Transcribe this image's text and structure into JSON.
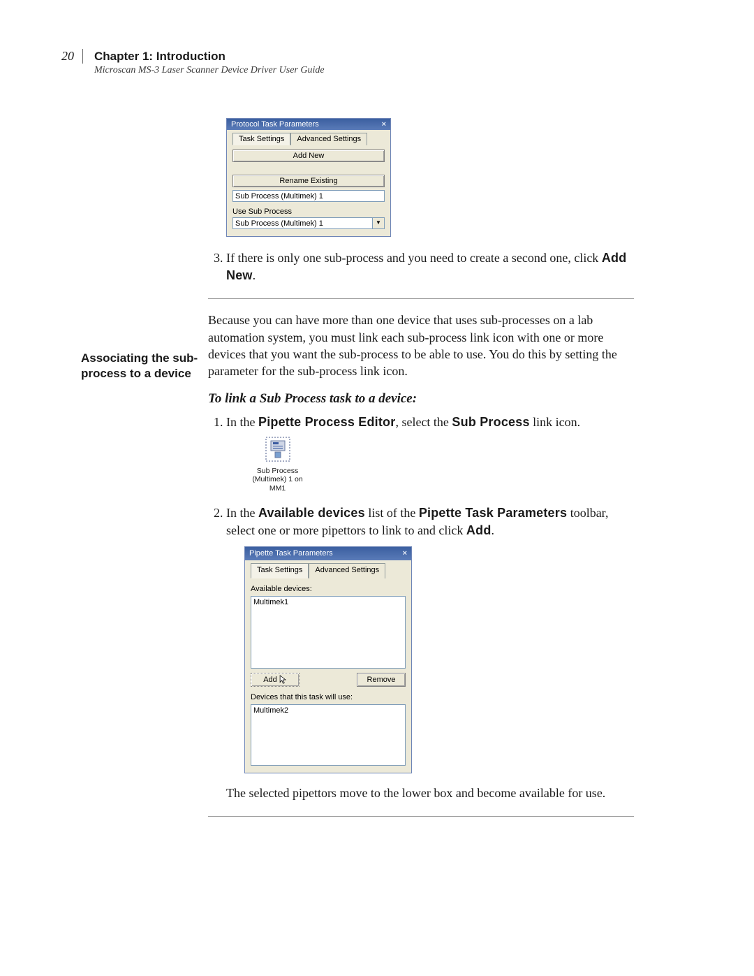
{
  "page": {
    "number": "20",
    "chapter": "Chapter 1: Introduction",
    "guide": "Microscan MS-3 Laser Scanner Device Driver User Guide"
  },
  "shot1": {
    "title": "Protocol Task Parameters",
    "close": "×",
    "tab1": "Task Settings",
    "tab2": "Advanced Settings",
    "addNew": "Add New",
    "rename": "Rename Existing",
    "renameVal": "Sub Process (Multimek) 1",
    "useLabel": "Use Sub Process",
    "selectVal": "Sub Process (Multimek) 1",
    "dropGlyph": "▼"
  },
  "step3": {
    "pre": "If there is only one sub-process and you need to create a second one, click ",
    "bold": "Add New",
    "post": "."
  },
  "assoc": {
    "heading": "Associating the sub-process to a device",
    "para": "Because you can have more than one device that uses sub-processes on a lab automation system, you must link each sub-process link icon with one or more devices that you want the sub-process to be able to use. You do this by setting the parameter for the sub-process link icon.",
    "subhead": "To link a Sub Process task to a device:"
  },
  "step1": {
    "a": "In the ",
    "b": "Pipette Process Editor",
    "c": ", select the ",
    "d": "Sub Process",
    "e": " link icon."
  },
  "icon": {
    "line1": "Sub Process",
    "line2": "(Multimek) 1 on",
    "line3": "MM1"
  },
  "step2": {
    "a": "In the ",
    "b": "Available devices",
    "c": " list of the ",
    "d": "Pipette Task Parameters",
    "e": " toolbar, select one or more pipettors to link to and click ",
    "f": "Add",
    "g": "."
  },
  "shot2": {
    "title": "Pipette Task Parameters",
    "close": "×",
    "tab1": "Task Settings",
    "tab2": "Advanced Settings",
    "availLabel": "Available devices:",
    "availItem": "Multimek1",
    "add": "Add",
    "remove": "Remove",
    "usedLabel": "Devices that this task will use:",
    "usedItem": "Multimek2"
  },
  "after2": "The selected pipettors move to the lower box and become available for use."
}
